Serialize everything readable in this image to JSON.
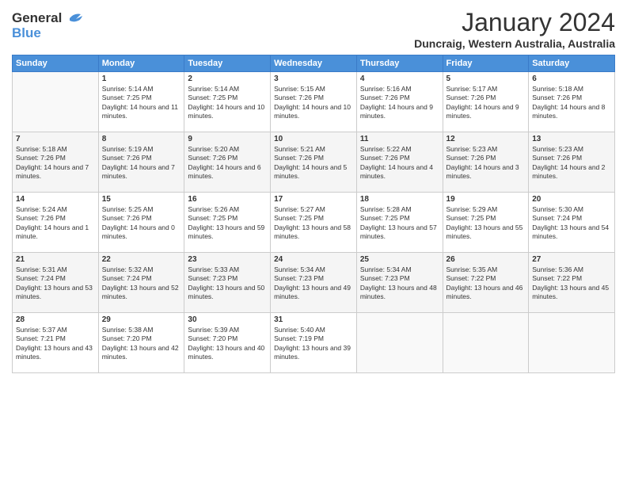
{
  "header": {
    "logo_line1": "General",
    "logo_line2": "Blue",
    "title": "January 2024",
    "subtitle": "Duncraig, Western Australia, Australia"
  },
  "days_of_week": [
    "Sunday",
    "Monday",
    "Tuesday",
    "Wednesday",
    "Thursday",
    "Friday",
    "Saturday"
  ],
  "weeks": [
    [
      {
        "day": "",
        "sunrise": "",
        "sunset": "",
        "daylight": ""
      },
      {
        "day": "1",
        "sunrise": "Sunrise: 5:14 AM",
        "sunset": "Sunset: 7:25 PM",
        "daylight": "Daylight: 14 hours and 11 minutes."
      },
      {
        "day": "2",
        "sunrise": "Sunrise: 5:14 AM",
        "sunset": "Sunset: 7:25 PM",
        "daylight": "Daylight: 14 hours and 10 minutes."
      },
      {
        "day": "3",
        "sunrise": "Sunrise: 5:15 AM",
        "sunset": "Sunset: 7:26 PM",
        "daylight": "Daylight: 14 hours and 10 minutes."
      },
      {
        "day": "4",
        "sunrise": "Sunrise: 5:16 AM",
        "sunset": "Sunset: 7:26 PM",
        "daylight": "Daylight: 14 hours and 9 minutes."
      },
      {
        "day": "5",
        "sunrise": "Sunrise: 5:17 AM",
        "sunset": "Sunset: 7:26 PM",
        "daylight": "Daylight: 14 hours and 9 minutes."
      },
      {
        "day": "6",
        "sunrise": "Sunrise: 5:18 AM",
        "sunset": "Sunset: 7:26 PM",
        "daylight": "Daylight: 14 hours and 8 minutes."
      }
    ],
    [
      {
        "day": "7",
        "sunrise": "Sunrise: 5:18 AM",
        "sunset": "Sunset: 7:26 PM",
        "daylight": "Daylight: 14 hours and 7 minutes."
      },
      {
        "day": "8",
        "sunrise": "Sunrise: 5:19 AM",
        "sunset": "Sunset: 7:26 PM",
        "daylight": "Daylight: 14 hours and 7 minutes."
      },
      {
        "day": "9",
        "sunrise": "Sunrise: 5:20 AM",
        "sunset": "Sunset: 7:26 PM",
        "daylight": "Daylight: 14 hours and 6 minutes."
      },
      {
        "day": "10",
        "sunrise": "Sunrise: 5:21 AM",
        "sunset": "Sunset: 7:26 PM",
        "daylight": "Daylight: 14 hours and 5 minutes."
      },
      {
        "day": "11",
        "sunrise": "Sunrise: 5:22 AM",
        "sunset": "Sunset: 7:26 PM",
        "daylight": "Daylight: 14 hours and 4 minutes."
      },
      {
        "day": "12",
        "sunrise": "Sunrise: 5:23 AM",
        "sunset": "Sunset: 7:26 PM",
        "daylight": "Daylight: 14 hours and 3 minutes."
      },
      {
        "day": "13",
        "sunrise": "Sunrise: 5:23 AM",
        "sunset": "Sunset: 7:26 PM",
        "daylight": "Daylight: 14 hours and 2 minutes."
      }
    ],
    [
      {
        "day": "14",
        "sunrise": "Sunrise: 5:24 AM",
        "sunset": "Sunset: 7:26 PM",
        "daylight": "Daylight: 14 hours and 1 minute."
      },
      {
        "day": "15",
        "sunrise": "Sunrise: 5:25 AM",
        "sunset": "Sunset: 7:26 PM",
        "daylight": "Daylight: 14 hours and 0 minutes."
      },
      {
        "day": "16",
        "sunrise": "Sunrise: 5:26 AM",
        "sunset": "Sunset: 7:25 PM",
        "daylight": "Daylight: 13 hours and 59 minutes."
      },
      {
        "day": "17",
        "sunrise": "Sunrise: 5:27 AM",
        "sunset": "Sunset: 7:25 PM",
        "daylight": "Daylight: 13 hours and 58 minutes."
      },
      {
        "day": "18",
        "sunrise": "Sunrise: 5:28 AM",
        "sunset": "Sunset: 7:25 PM",
        "daylight": "Daylight: 13 hours and 57 minutes."
      },
      {
        "day": "19",
        "sunrise": "Sunrise: 5:29 AM",
        "sunset": "Sunset: 7:25 PM",
        "daylight": "Daylight: 13 hours and 55 minutes."
      },
      {
        "day": "20",
        "sunrise": "Sunrise: 5:30 AM",
        "sunset": "Sunset: 7:24 PM",
        "daylight": "Daylight: 13 hours and 54 minutes."
      }
    ],
    [
      {
        "day": "21",
        "sunrise": "Sunrise: 5:31 AM",
        "sunset": "Sunset: 7:24 PM",
        "daylight": "Daylight: 13 hours and 53 minutes."
      },
      {
        "day": "22",
        "sunrise": "Sunrise: 5:32 AM",
        "sunset": "Sunset: 7:24 PM",
        "daylight": "Daylight: 13 hours and 52 minutes."
      },
      {
        "day": "23",
        "sunrise": "Sunrise: 5:33 AM",
        "sunset": "Sunset: 7:23 PM",
        "daylight": "Daylight: 13 hours and 50 minutes."
      },
      {
        "day": "24",
        "sunrise": "Sunrise: 5:34 AM",
        "sunset": "Sunset: 7:23 PM",
        "daylight": "Daylight: 13 hours and 49 minutes."
      },
      {
        "day": "25",
        "sunrise": "Sunrise: 5:34 AM",
        "sunset": "Sunset: 7:23 PM",
        "daylight": "Daylight: 13 hours and 48 minutes."
      },
      {
        "day": "26",
        "sunrise": "Sunrise: 5:35 AM",
        "sunset": "Sunset: 7:22 PM",
        "daylight": "Daylight: 13 hours and 46 minutes."
      },
      {
        "day": "27",
        "sunrise": "Sunrise: 5:36 AM",
        "sunset": "Sunset: 7:22 PM",
        "daylight": "Daylight: 13 hours and 45 minutes."
      }
    ],
    [
      {
        "day": "28",
        "sunrise": "Sunrise: 5:37 AM",
        "sunset": "Sunset: 7:21 PM",
        "daylight": "Daylight: 13 hours and 43 minutes."
      },
      {
        "day": "29",
        "sunrise": "Sunrise: 5:38 AM",
        "sunset": "Sunset: 7:20 PM",
        "daylight": "Daylight: 13 hours and 42 minutes."
      },
      {
        "day": "30",
        "sunrise": "Sunrise: 5:39 AM",
        "sunset": "Sunset: 7:20 PM",
        "daylight": "Daylight: 13 hours and 40 minutes."
      },
      {
        "day": "31",
        "sunrise": "Sunrise: 5:40 AM",
        "sunset": "Sunset: 7:19 PM",
        "daylight": "Daylight: 13 hours and 39 minutes."
      },
      {
        "day": "",
        "sunrise": "",
        "sunset": "",
        "daylight": ""
      },
      {
        "day": "",
        "sunrise": "",
        "sunset": "",
        "daylight": ""
      },
      {
        "day": "",
        "sunrise": "",
        "sunset": "",
        "daylight": ""
      }
    ]
  ]
}
